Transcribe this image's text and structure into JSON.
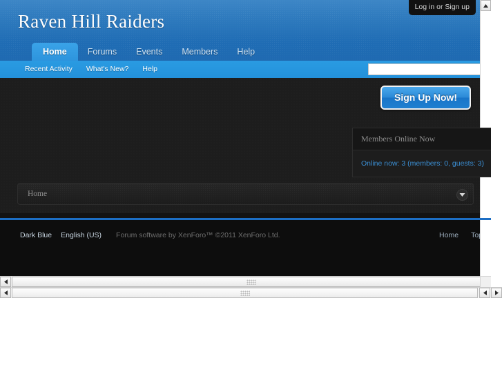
{
  "header": {
    "site_title": "Raven Hill Raiders",
    "login_label": "Log in or Sign up",
    "nav_tabs": [
      {
        "label": "Home",
        "active": true
      },
      {
        "label": "Forums",
        "active": false
      },
      {
        "label": "Events",
        "active": false
      },
      {
        "label": "Members",
        "active": false
      },
      {
        "label": "Help",
        "active": false
      }
    ],
    "subnav": [
      {
        "label": "Recent Activity"
      },
      {
        "label": "What's New?"
      },
      {
        "label": "Help"
      }
    ],
    "search": {
      "value": "",
      "placeholder": ""
    }
  },
  "main": {
    "signup_label": "Sign Up Now!",
    "online_panel": {
      "title": "Members Online Now",
      "status": "Online now: 3 (members: 0, guests: 3)"
    },
    "breadcrumb": {
      "home": "Home",
      "dropdown_icon": "chevron-down-icon"
    }
  },
  "footer": {
    "style_label": "Dark Blue",
    "language_label": "English (US)",
    "copyright": "Forum software by XenForo™ ©2011 XenForo Ltd.",
    "right_links": [
      {
        "label": "Home"
      },
      {
        "label": "Top"
      }
    ]
  },
  "colors": {
    "header_blue": "#2f7bbe",
    "subnav_blue": "#2a9be2",
    "accent_blue": "#1c6ec4",
    "link_blue": "#3b8fd4",
    "content_dark": "#1d1d1d",
    "footer_dark": "#0d0d0d"
  },
  "scrollbars": {
    "vertical_up": "scroll-up-arrow-icon",
    "vertical_down": "scroll-down-arrow-icon",
    "horizontal_left": "scroll-left-arrow-icon",
    "horizontal_right": "scroll-right-arrow-icon"
  }
}
